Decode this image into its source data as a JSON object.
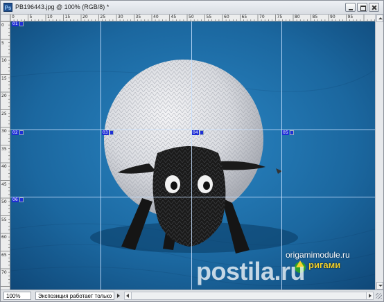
{
  "window": {
    "title": "PB196443.jpg @ 100% (RGB/8) *",
    "app_icon_text": "Ps"
  },
  "rulers": {
    "top_labels": [
      "0",
      "5",
      "10",
      "15",
      "20",
      "25",
      "30",
      "35",
      "40",
      "45",
      "50",
      "55",
      "60",
      "65",
      "70",
      "75",
      "80",
      "85",
      "90",
      "95"
    ],
    "left_labels": [
      "0",
      "5",
      "10",
      "15",
      "20",
      "25",
      "30",
      "35",
      "40",
      "45",
      "50",
      "55",
      "60",
      "65",
      "70"
    ]
  },
  "slices": {
    "markers": [
      "01",
      "02",
      "03",
      "04",
      "05",
      "06"
    ]
  },
  "watermark": {
    "site": "origamimodule.ru",
    "logo_word": "ригами",
    "big": "postila.ru"
  },
  "status": {
    "zoom": "100%",
    "text": "Экспозиция работает только в ..."
  },
  "colors": {
    "background_towel": "#1d6aa0",
    "guide": "#c8e1ff",
    "slice_marker": "#1f2fd6"
  }
}
